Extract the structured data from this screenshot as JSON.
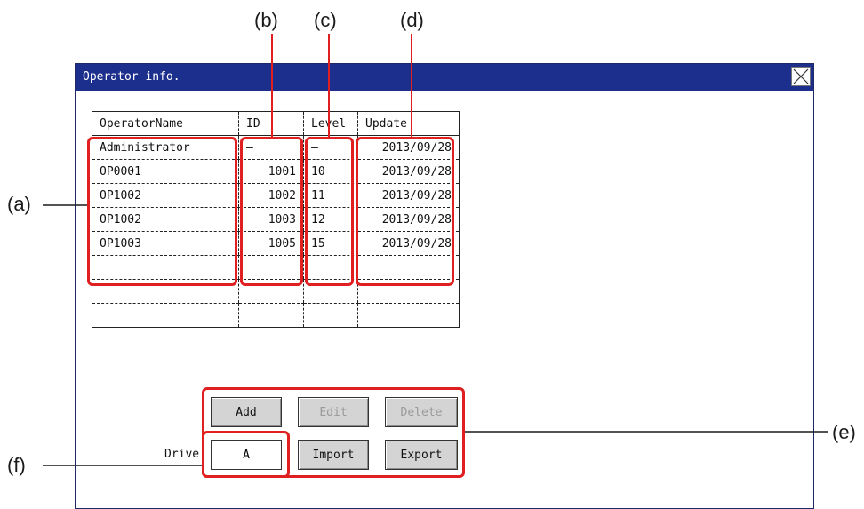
{
  "callouts": {
    "a": "(a)",
    "b": "(b)",
    "c": "(c)",
    "d": "(d)",
    "e": "(e)",
    "f": "(f)"
  },
  "window": {
    "title": "Operator info.",
    "close_icon": "close-x-icon"
  },
  "table": {
    "headers": [
      "OperatorName",
      "ID",
      "Level",
      "Update"
    ],
    "rows": [
      [
        "Administrator",
        "–",
        "–",
        "2013/09/28"
      ],
      [
        "OP0001",
        "1001",
        "10",
        "2013/09/28"
      ],
      [
        "OP1002",
        "1002",
        "11",
        "2013/09/28"
      ],
      [
        "OP1002",
        "1003",
        "12",
        "2013/09/28"
      ],
      [
        "OP1003",
        "1005",
        "15",
        "2013/09/28"
      ],
      [
        "",
        "",
        "",
        ""
      ],
      [
        "",
        "",
        "",
        ""
      ],
      [
        "",
        "",
        "",
        ""
      ]
    ]
  },
  "buttons": {
    "add": "Add",
    "edit": "Edit",
    "delete": "Delete",
    "import": "Import",
    "export": "Export"
  },
  "drive": {
    "label": "Drive",
    "value": "A"
  },
  "colors": {
    "titlebar": "#1d2f8c",
    "highlight": "#e02020",
    "button": "#d4d4d4"
  }
}
